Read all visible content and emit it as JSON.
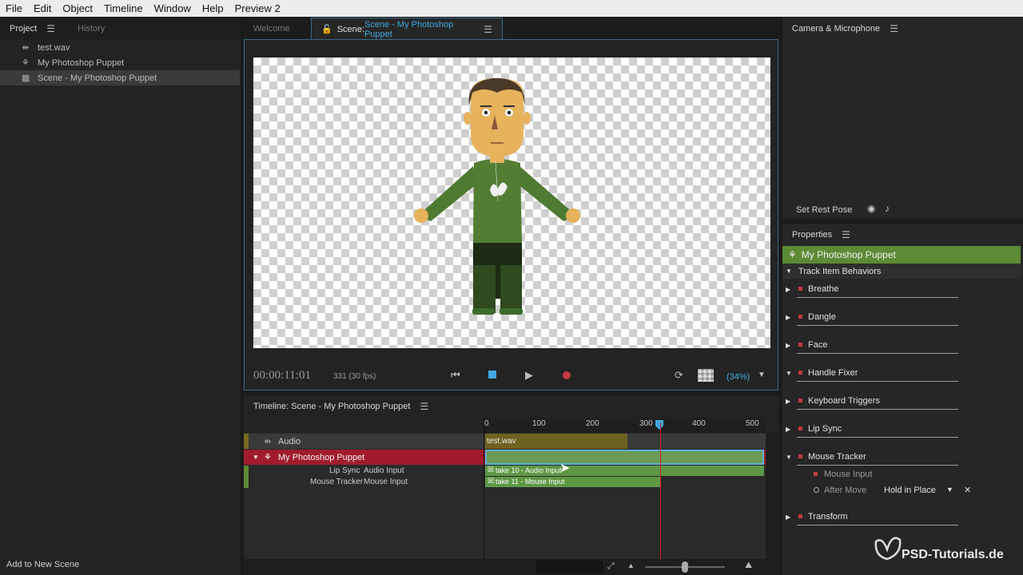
{
  "menu": [
    "File",
    "Edit",
    "Object",
    "Timeline",
    "Window",
    "Help",
    "Preview 2"
  ],
  "project": {
    "tabs": [
      "Project",
      "History"
    ],
    "items": [
      {
        "label": "test.wav",
        "icon": "audio-icon"
      },
      {
        "label": "My Photoshop Puppet",
        "icon": "puppet-icon"
      },
      {
        "label": "Scene - My Photoshop Puppet",
        "icon": "scene-icon",
        "selected": true
      }
    ],
    "add_scene": "Add to New Scene"
  },
  "scene": {
    "tab_welcome": "Welcome",
    "tab_scene_prefix": "Scene:",
    "tab_scene_name": "Scene - My Photoshop Puppet",
    "timecode": "00:00:11:01",
    "frame_info": "331 (30 fps)",
    "zoom": "(34%)"
  },
  "camera": {
    "title": "Camera & Microphone",
    "set_rest_pose": "Set Rest Pose"
  },
  "properties": {
    "title": "Properties",
    "puppet": "My Photoshop Puppet",
    "group": "Track Item Behaviors",
    "behaviors": [
      "Breathe",
      "Dangle",
      "Face",
      "Handle Fixer",
      "Keyboard Triggers",
      "Lip Sync",
      "Mouse Tracker",
      "Transform"
    ],
    "mouse_input": "Mouse Input",
    "after_move": "After Move",
    "after_move_value": "Hold in Place"
  },
  "timeline": {
    "title": "Timeline: Scene - My Photoshop Puppet",
    "ticks": [
      "0",
      "100",
      "200",
      "300",
      "400",
      "500"
    ],
    "audio_track": "Audio",
    "audio_clip": "test.wav",
    "puppet_track": "My Photoshop Puppet",
    "rows": [
      {
        "behavior": "Lip Sync",
        "input": "Audio Input",
        "take": "take 10 - Audio Input"
      },
      {
        "behavior": "Mouse Tracker",
        "input": "Mouse Input",
        "take": "take 11 - Mouse Input"
      }
    ]
  },
  "watermark": "PSD-Tutorials.de",
  "colors": {
    "accent_blue": "#3fa8e0",
    "puppet_green": "#5c8a35",
    "record_red": "#c53a46"
  }
}
